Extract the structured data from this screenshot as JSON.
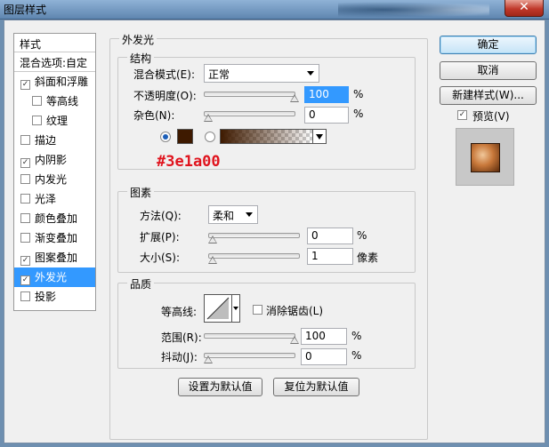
{
  "window": {
    "title": "图层样式",
    "close_glyph": "✕"
  },
  "styles_list": {
    "header": "样式",
    "blend_options": "混合选项:自定",
    "items": [
      {
        "label": "斜面和浮雕",
        "checked": true,
        "indent": false
      },
      {
        "label": "等高线",
        "checked": false,
        "indent": true
      },
      {
        "label": "纹理",
        "checked": false,
        "indent": true
      },
      {
        "label": "描边",
        "checked": false,
        "indent": false
      },
      {
        "label": "内阴影",
        "checked": true,
        "indent": false
      },
      {
        "label": "内发光",
        "checked": false,
        "indent": false
      },
      {
        "label": "光泽",
        "checked": false,
        "indent": false
      },
      {
        "label": "颜色叠加",
        "checked": false,
        "indent": false
      },
      {
        "label": "渐变叠加",
        "checked": false,
        "indent": false
      },
      {
        "label": "图案叠加",
        "checked": true,
        "indent": false
      },
      {
        "label": "外发光",
        "checked": true,
        "indent": false,
        "selected": true
      },
      {
        "label": "投影",
        "checked": false,
        "indent": false
      }
    ]
  },
  "outer_glow": {
    "title": "外发光",
    "structure": {
      "title": "结构",
      "blend_mode_label": "混合模式(E):",
      "blend_mode_value": "正常",
      "opacity_label": "不透明度(O):",
      "opacity_value": "100",
      "opacity_percent": 100,
      "noise_label": "杂色(N):",
      "noise_value": "0",
      "noise_percent": 0,
      "percent": "%",
      "color": "#3e1a00"
    },
    "elements": {
      "title": "图素",
      "technique_label": "方法(Q):",
      "technique_value": "柔和",
      "spread_label": "扩展(P):",
      "spread_value": "0",
      "spread_percent": 0,
      "size_label": "大小(S):",
      "size_value": "1",
      "size_unit": "像素",
      "percent": "%"
    },
    "quality": {
      "title": "品质",
      "contour_label": "等高线:",
      "anti_alias_label": "消除锯齿(L)",
      "range_label": "范围(R):",
      "range_value": "100",
      "range_percent": 100,
      "jitter_label": "抖动(J):",
      "jitter_value": "0",
      "jitter_percent": 0,
      "percent": "%"
    },
    "set_default": "设置为默认值",
    "reset_default": "复位为默认值"
  },
  "annotation": "#3e1a00",
  "buttons": {
    "ok": "确定",
    "cancel": "取消",
    "new_style": "新建样式(W)...",
    "preview_label": "预览(V)",
    "preview_checked": true
  }
}
